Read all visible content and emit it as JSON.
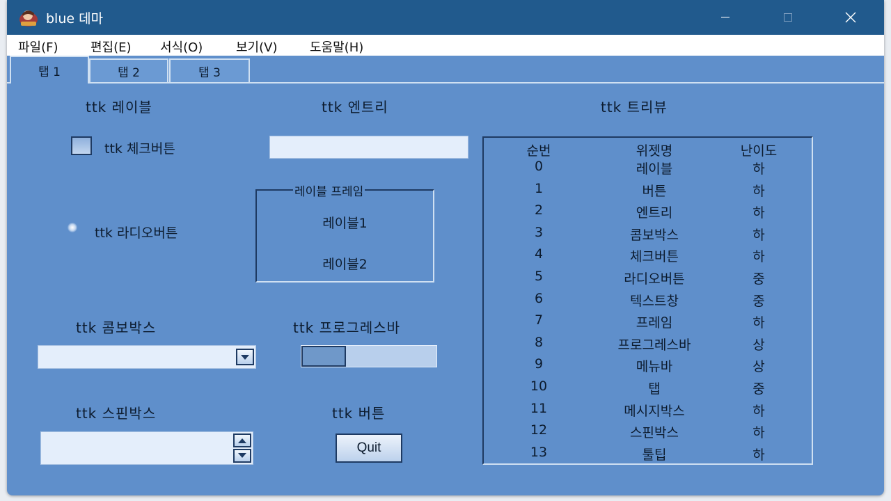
{
  "window": {
    "title": "blue 데마"
  },
  "menu": [
    "파일(F)",
    "편집(E)",
    "서식(O)",
    "보기(V)",
    "도움말(H)"
  ],
  "tabs": [
    "탭 1",
    "탭 2",
    "탭 3"
  ],
  "labels": {
    "label": "ttk 레이블",
    "entry": "ttk 엔트리",
    "treeview": "ttk 트리뷰",
    "combobox": "ttk 콤보박스",
    "progressbar": "ttk 프로그레스바",
    "spinbox": "ttk 스핀박스",
    "button": "ttk 버튼"
  },
  "checkbutton": {
    "text": "ttk 체크버튼",
    "checked": false
  },
  "radiobutton": {
    "text": "ttk 라디오버튼"
  },
  "entry_value": "",
  "label_frame": {
    "title": "레이블 프레임",
    "label1": "레이블1",
    "label2": "레이블2"
  },
  "combobox_value": "",
  "progress": {
    "fraction": 0.33
  },
  "spinbox_value": "",
  "quit_button": "Quit",
  "tree": {
    "columns": [
      "순번",
      "위젯명",
      "난이도"
    ],
    "rows": [
      [
        "0",
        "레이블",
        "하"
      ],
      [
        "1",
        "버튼",
        "하"
      ],
      [
        "2",
        "엔트리",
        "하"
      ],
      [
        "3",
        "콤보박스",
        "하"
      ],
      [
        "4",
        "체크버튼",
        "하"
      ],
      [
        "5",
        "라디오버튼",
        "중"
      ],
      [
        "6",
        "텍스트창",
        "중"
      ],
      [
        "7",
        "프레임",
        "하"
      ],
      [
        "8",
        "프로그레스바",
        "상"
      ],
      [
        "9",
        "메뉴바",
        "상"
      ],
      [
        "10",
        "탭",
        "중"
      ],
      [
        "11",
        "메시지박스",
        "하"
      ],
      [
        "12",
        "스핀박스",
        "하"
      ],
      [
        "13",
        "툴팁",
        "하"
      ]
    ]
  },
  "colors": {
    "titlebar": "#215a8d",
    "background": "#5f8fcb",
    "menubar": "#ffffff"
  },
  "icons": [
    "app-icon",
    "minimize-icon",
    "maximize-icon",
    "close-icon",
    "dropdown-arrow-icon",
    "spin-up-icon",
    "spin-down-icon"
  ]
}
